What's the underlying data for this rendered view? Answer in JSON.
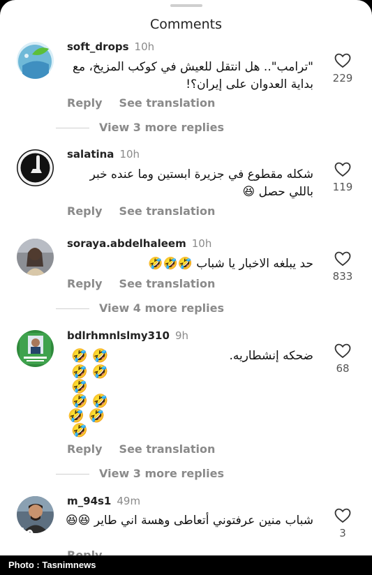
{
  "header": {
    "title": "Comments"
  },
  "comments": [
    {
      "username": "soft_drops",
      "time": "10h",
      "text": "\"ترامب\".. هل انتقل للعيش في كوكب المزيخ، مع بداية العدوان على إيران؟!",
      "likes": "229",
      "reply_label": "Reply",
      "translate_label": "See translation",
      "more_replies": "View 3 more replies"
    },
    {
      "username": "salatina",
      "time": "10h",
      "text": "شكله مقطوع في جزيرة ابستين وما عنده خبر باللي حصل",
      "likes": "119",
      "reply_label": "Reply",
      "translate_label": "See translation"
    },
    {
      "username": "soraya.abdelhaleem",
      "time": "10h",
      "text": "حد يبلغه الاخبار يا شباب",
      "likes": "833",
      "reply_label": "Reply",
      "translate_label": "See translation",
      "more_replies": "View 4 more replies"
    },
    {
      "username": "bdlrhmnlslmy310",
      "time": "9h",
      "text": "ضحكه إنشطاريه.",
      "likes": "68",
      "reply_label": "Reply",
      "translate_label": "See translation",
      "more_replies": "View 3 more replies"
    },
    {
      "username": "m_94s1",
      "time": "49m",
      "text": "شباب منين عرفتوني أتعاطى وهسة اني طاير",
      "likes": "3",
      "reply_label": "Reply"
    }
  ],
  "emojis": {
    "laugh": "🤣",
    "grin": "😆"
  },
  "footer": {
    "credit": "Photo : Tasnimnews"
  },
  "colors": {
    "background": "#ffffff",
    "secondary_text": "#8a8a8a",
    "footer_bg": "#000000"
  },
  "icons": {
    "like": "heart-outline-icon"
  }
}
